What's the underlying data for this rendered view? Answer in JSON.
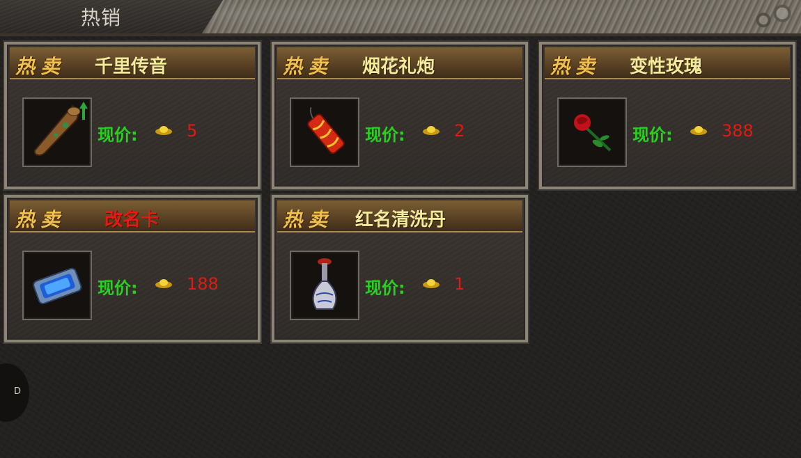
{
  "header": {
    "title": "热销"
  },
  "cards": [
    {
      "tag": "热卖",
      "name": "千里传音",
      "price_label": "现价:",
      "price": "5",
      "icon": "horn-icon",
      "name_color": "#f4ea9c"
    },
    {
      "tag": "热卖",
      "name": "烟花礼炮",
      "price_label": "现价:",
      "price": "2",
      "icon": "firecracker-icon",
      "name_color": "#f4ea9c"
    },
    {
      "tag": "热卖",
      "name": "变性玫瑰",
      "price_label": "现价:",
      "price": "388",
      "icon": "rose-icon",
      "name_color": "#f4ea9c"
    },
    {
      "tag": "热卖",
      "name": "改名卡",
      "price_label": "现价:",
      "price": "188",
      "icon": "scroll-icon",
      "name_color": "#e61a12"
    },
    {
      "tag": "热卖",
      "name": "红名清洗丹",
      "price_label": "现价:",
      "price": "1",
      "icon": "vase-icon",
      "name_color": "#f4ea9c"
    }
  ],
  "currency_icon": "gold-ingot-icon",
  "side_button": {
    "label": "D"
  }
}
